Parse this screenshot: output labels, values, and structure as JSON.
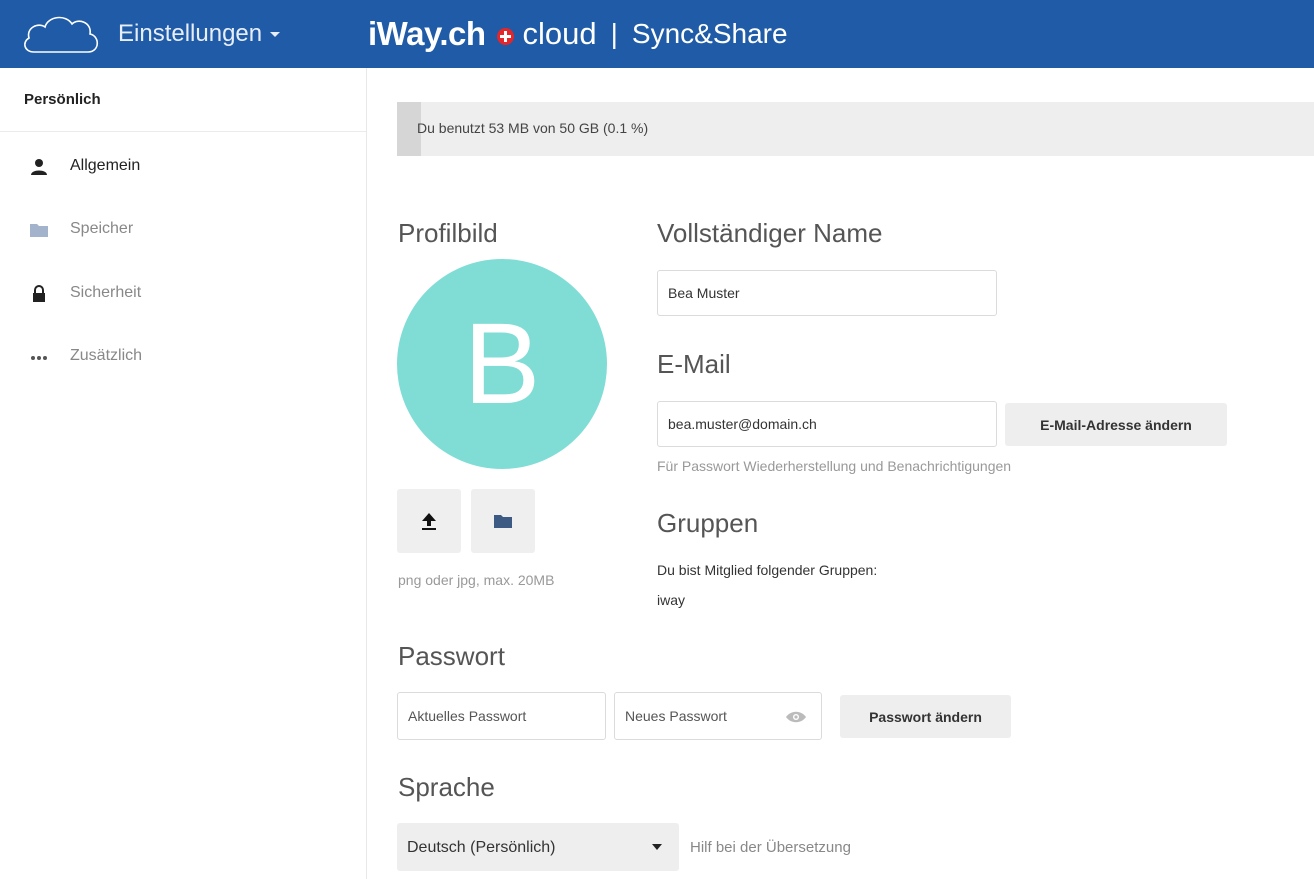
{
  "header": {
    "settings_menu_label": "Einstellungen",
    "brand_iway": "iWay.ch",
    "brand_cloud": "cloud",
    "brand_separator": "|",
    "brand_product": "Sync&Share",
    "colors": {
      "bar": "#1f5ba6",
      "swiss_cross": "#e3262a"
    }
  },
  "sidebar": {
    "title": "Persönlich",
    "items": [
      {
        "label": "Allgemein",
        "icon": "user-icon",
        "active": true
      },
      {
        "label": "Speicher",
        "icon": "folder-icon",
        "active": false
      },
      {
        "label": "Sicherheit",
        "icon": "lock-icon",
        "active": false
      },
      {
        "label": "Zusätzlich",
        "icon": "more-dots-icon",
        "active": false
      }
    ]
  },
  "quota": {
    "text": "Du benutzt 53 MB von 50 GB (0.1 %)",
    "used_fraction": 0.001
  },
  "profile_picture": {
    "title": "Profilbild",
    "initial": "B",
    "avatar_color": "#7fddd6",
    "upload_icon": "upload-icon",
    "choose_icon": "folder-icon",
    "hint": "png oder jpg, max. 20MB"
  },
  "full_name": {
    "title": "Vollständiger Name",
    "value": "Bea Muster"
  },
  "email": {
    "title": "E-Mail",
    "value": "bea.muster@domain.ch",
    "button": "E-Mail-Adresse ändern",
    "hint": "Für Passwort Wiederherstellung und Benachrichtigungen"
  },
  "groups": {
    "title": "Gruppen",
    "description": "Du bist Mitglied folgender Gruppen:",
    "list": "iway"
  },
  "password": {
    "title": "Passwort",
    "current_placeholder": "Aktuelles Passwort",
    "new_placeholder": "Neues Passwort",
    "toggle_icon": "eye-icon",
    "button": "Passwort ändern"
  },
  "language": {
    "title": "Sprache",
    "selected": "Deutsch (Persönlich)",
    "help_link": "Hilf bei der Übersetzung"
  }
}
